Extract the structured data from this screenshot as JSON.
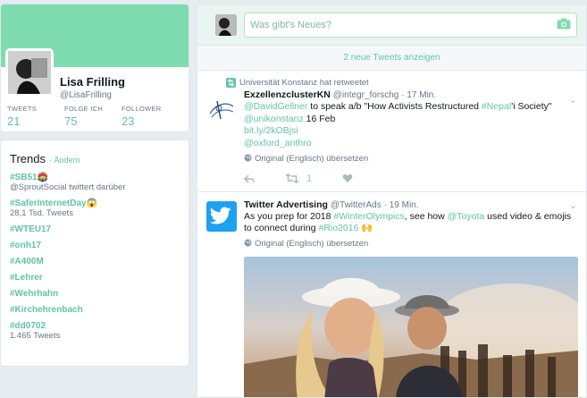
{
  "profile": {
    "name": "Lisa Frilling",
    "handle": "@LisaFrilling",
    "stats": [
      {
        "label": "TWEETS",
        "value": "21"
      },
      {
        "label": "FOLGE ICH",
        "value": "75"
      },
      {
        "label": "FOLLOWER",
        "value": "23"
      }
    ]
  },
  "trends": {
    "title": "Trends",
    "change": "· Ändern",
    "items": [
      {
        "tag": "#SB51🏟️",
        "sub": "@SproutSocial twittert darüber"
      },
      {
        "tag": "#SaferInternetDay😱",
        "sub": "28,1 Tsd. Tweets"
      },
      {
        "tag": "#WTEU17",
        "sub": ""
      },
      {
        "tag": "#onh17",
        "sub": ""
      },
      {
        "tag": "#A400M",
        "sub": ""
      },
      {
        "tag": "#Lehrer",
        "sub": ""
      },
      {
        "tag": "#Wehrhahn",
        "sub": ""
      },
      {
        "tag": "#Kirchehrenbach",
        "sub": ""
      },
      {
        "tag": "#dd0702",
        "sub": "1.465 Tweets"
      }
    ]
  },
  "compose": {
    "placeholder": "Was gibt's Neues?"
  },
  "new_tweets": "2 neue Tweets anzeigen",
  "tweets": [
    {
      "retweet_by": "Universität Konstanz hat retweetet",
      "name": "ExzellenzclusterKN",
      "handle": "@integr_forschg",
      "time": "· 17 Min.",
      "text_parts": {
        "m1": "@DavidGellner",
        "t1": " to speak a/b \"How Activists Restructured ",
        "h1": "#Nepal",
        "t2": "'i Society\"",
        "m2": "@unikonstanz",
        "t3": " 16 Feb",
        "l1": "bit.ly/2kOBjsi",
        "m3": "@oxford_anthro"
      },
      "translate": "Original (Englisch) übersetzen",
      "retweets": "1"
    },
    {
      "name": "Twitter Advertising",
      "handle": "@TwitterAds",
      "time": "· 19 Min.",
      "text_parts": {
        "t1": "As you prep for 2018 ",
        "h1": "#WinterOlympics",
        "t2": ", see how ",
        "m1": "@Toyota",
        "t3": " used video & emojis to connect during ",
        "h2": "#Rio2016",
        "t4": " 🙌"
      },
      "translate": "Original (Englisch) übersetzen"
    }
  ]
}
